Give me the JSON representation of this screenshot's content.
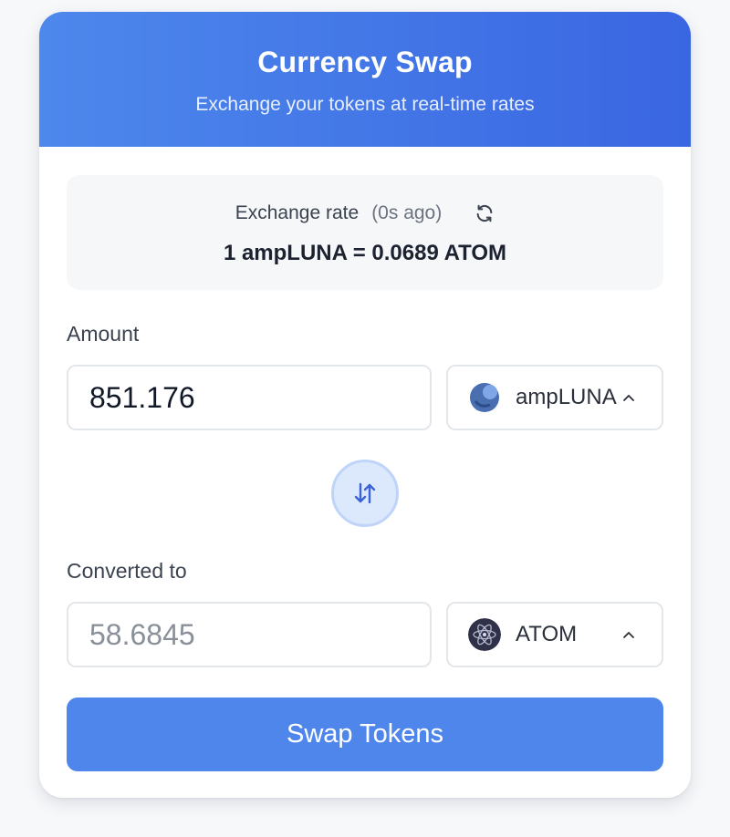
{
  "header": {
    "title": "Currency Swap",
    "subtitle": "Exchange your tokens at real-time rates"
  },
  "rate": {
    "label": "Exchange rate",
    "age": "(0s ago)",
    "value": "1 ampLUNA = 0.0689 ATOM",
    "refresh_icon": "refresh-icon"
  },
  "from": {
    "label": "Amount",
    "value": "851.176",
    "token": "ampLUNA",
    "token_icon": "ampluna-icon"
  },
  "swap_direction_icon": "swap-arrows-icon",
  "to": {
    "label": "Converted to",
    "value": "58.6845",
    "token": "ATOM",
    "token_icon": "atom-icon"
  },
  "action": {
    "label": "Swap Tokens"
  },
  "colors": {
    "accent": "#4f86ec",
    "header_gradient_start": "#4d88ec",
    "header_gradient_end": "#3a66e2"
  }
}
